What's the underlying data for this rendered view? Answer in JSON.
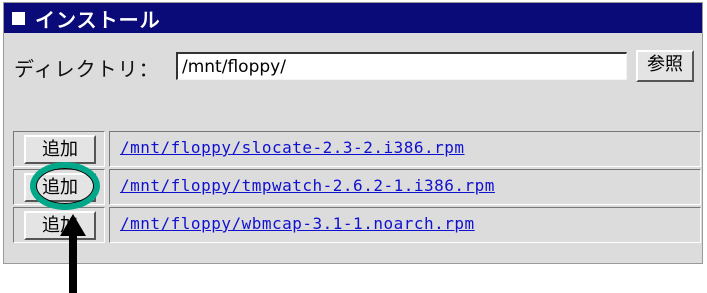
{
  "window": {
    "title": "インストール"
  },
  "directory": {
    "label": "ディレクトリ：",
    "value": "/mnt/floppy/",
    "browse_label": "参照"
  },
  "files": [
    {
      "button_label": "追加",
      "path": "/mnt/floppy/slocate-2.3-2.i386.rpm"
    },
    {
      "button_label": "追加",
      "path": "/mnt/floppy/tmpwatch-2.6.2-1.i386.rpm"
    },
    {
      "button_label": "追加",
      "path": "/mnt/floppy/wbmcap-3.1-1.noarch.rpm"
    }
  ],
  "colors": {
    "titlebar": "#0a0a78",
    "panel": "#dcdcdc",
    "link": "#1010d0",
    "highlight_ring": "#00a88a"
  },
  "annotations": {
    "highlight": "circle around add button of row 2",
    "pointer": "arrow-up-icon"
  }
}
